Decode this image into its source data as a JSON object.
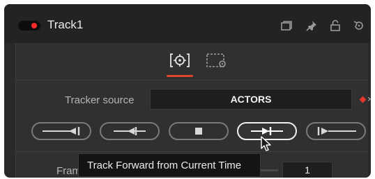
{
  "header": {
    "title": "Track1",
    "icons": [
      "toggle-switch",
      "window-icon",
      "pin-icon",
      "lock-icon",
      "reset-icon"
    ]
  },
  "tabs": [
    {
      "name": "tracker-tab",
      "icon": "target-icon",
      "active": true
    },
    {
      "name": "settings-tab",
      "icon": "settings-icon",
      "active": false
    }
  ],
  "tracker_source": {
    "label": "Tracker source",
    "value": "ACTORS"
  },
  "track_buttons": [
    {
      "name": "track-backward-from-end",
      "icon": "arrow-left-from-bar-icon"
    },
    {
      "name": "track-backward-from-current",
      "icon": "arrow-left-icon"
    },
    {
      "name": "stop-tracking",
      "icon": "stop-icon"
    },
    {
      "name": "track-forward-from-current",
      "icon": "arrow-right-icon",
      "hover": true
    },
    {
      "name": "track-forward-from-start",
      "icon": "arrow-right-from-bar-icon"
    }
  ],
  "frames": {
    "label": "Fram",
    "value": "1"
  },
  "tooltip": {
    "text": "Track Forward from Current Time"
  },
  "colors": {
    "accent": "#e0472c",
    "toggle_on": "#ff2a2a",
    "panel_bg": "#2a2a2a"
  }
}
